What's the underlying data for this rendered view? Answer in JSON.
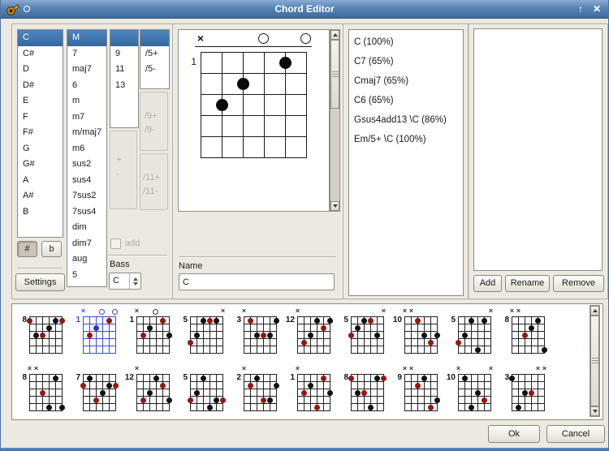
{
  "window": {
    "title": "Chord Editor",
    "maximize_glyph": "↑",
    "close_glyph": "✕"
  },
  "colors": {
    "titlebar_blue": "#5584b6",
    "selection_blue": "#35679f",
    "selected_diagram_blue": "#3f4cd9",
    "root_dot_red": "#991414",
    "note_dot_black": "#111111",
    "alt_dot_blue": "#2b35c8",
    "window_bg": "#ece9e2"
  },
  "roots": {
    "items": [
      "C",
      "C#",
      "D",
      "D#",
      "E",
      "F",
      "F#",
      "G",
      "G#",
      "A",
      "A#",
      "B"
    ],
    "selected": "C"
  },
  "accidentals": {
    "sharp": "#",
    "flat": "b",
    "active": "#"
  },
  "settings_button": "Settings",
  "types": {
    "items": [
      "M",
      "7",
      "maj7",
      "6",
      "m",
      "m7",
      "m/maj7",
      "m6",
      "sus2",
      "sus4",
      "7sus2",
      "7sus4",
      "dim",
      "dim7",
      "aug",
      "5"
    ],
    "selected": "M"
  },
  "extensions": {
    "items": [
      "9",
      "11",
      "13"
    ],
    "selected": ""
  },
  "plus_minus": {
    "plus": "+",
    "minus": "-"
  },
  "add_checkbox": {
    "label": "add",
    "checked": false,
    "enabled": false
  },
  "bass": {
    "label": "Bass",
    "value": "C"
  },
  "alterations": {
    "group5": [
      "/5+",
      "/5-"
    ],
    "group9": [
      "/9+",
      "/9-"
    ],
    "group11": [
      "/11+",
      "/11-"
    ]
  },
  "editor": {
    "fret": "1",
    "markers": [
      {
        "s": 1,
        "t": "x"
      },
      {
        "s": 4,
        "t": "o"
      },
      {
        "s": 6,
        "t": "o"
      }
    ],
    "dots": [
      {
        "s": 5,
        "f": 1
      },
      {
        "s": 3,
        "f": 2
      },
      {
        "s": 2,
        "f": 3
      }
    ],
    "name_label": "Name",
    "name_value": "C"
  },
  "chord_names": [
    "C (100%)",
    "C7 (65%)",
    "Cmaj7 (65%)",
    "C6 (65%)",
    "Gsus4add13 \\C (86%)",
    "Em/5+ \\C (100%)"
  ],
  "library_buttons": {
    "add": "Add",
    "rename": "Rename",
    "remove": "Remove"
  },
  "footer": {
    "ok": "Ok",
    "cancel": "Cancel"
  },
  "diagrams": {
    "rows": [
      [
        {
          "fret": "8",
          "m": [],
          "dots": [
            {
              "s": 1,
              "f": 1,
              "c": "r"
            },
            {
              "s": 5,
              "f": 1,
              "c": "k"
            },
            {
              "s": 6,
              "f": 1,
              "c": "r"
            },
            {
              "s": 4,
              "f": 2,
              "c": "k"
            },
            {
              "s": 2,
              "f": 3,
              "c": "k"
            },
            {
              "s": 3,
              "f": 3,
              "c": "r"
            }
          ]
        },
        {
          "fret": "1",
          "sel": true,
          "m": [
            {
              "s": 1,
              "t": "x"
            },
            {
              "s": 4,
              "t": "o"
            },
            {
              "s": 6,
              "t": "o"
            }
          ],
          "dots": [
            {
              "s": 5,
              "f": 1,
              "c": "r"
            },
            {
              "s": 3,
              "f": 2,
              "c": "b"
            },
            {
              "s": 2,
              "f": 3,
              "c": "r"
            }
          ]
        },
        {
          "fret": "1",
          "m": [
            {
              "s": 1,
              "t": "x"
            },
            {
              "s": 4,
              "t": "o"
            }
          ],
          "dots": [
            {
              "s": 5,
              "f": 1,
              "c": "r"
            },
            {
              "s": 3,
              "f": 2,
              "c": "k"
            },
            {
              "s": 2,
              "f": 3,
              "c": "r"
            },
            {
              "s": 6,
              "f": 3,
              "c": "k"
            }
          ]
        },
        {
          "fret": "5",
          "m": [
            {
              "s": 6,
              "t": "x"
            }
          ],
          "dots": [
            {
              "s": 3,
              "f": 1,
              "c": "k"
            },
            {
              "s": 4,
              "f": 1,
              "c": "r"
            },
            {
              "s": 5,
              "f": 1,
              "c": "k"
            },
            {
              "s": 2,
              "f": 3,
              "c": "k"
            },
            {
              "s": 1,
              "f": 4,
              "c": "r"
            }
          ]
        },
        {
          "fret": "3",
          "m": [
            {
              "s": 1,
              "t": "x"
            }
          ],
          "dots": [
            {
              "s": 2,
              "f": 1,
              "c": "r"
            },
            {
              "s": 6,
              "f": 1,
              "c": "k"
            },
            {
              "s": 3,
              "f": 3,
              "c": "k"
            },
            {
              "s": 4,
              "f": 3,
              "c": "r"
            },
            {
              "s": 5,
              "f": 3,
              "c": "k"
            }
          ]
        },
        {
          "fret": "12",
          "m": [
            {
              "s": 1,
              "t": "x"
            }
          ],
          "dots": [
            {
              "s": 4,
              "f": 1,
              "c": "k"
            },
            {
              "s": 6,
              "f": 1,
              "c": "k"
            },
            {
              "s": 5,
              "f": 2,
              "c": "r"
            },
            {
              "s": 3,
              "f": 3,
              "c": "k"
            },
            {
              "s": 2,
              "f": 4,
              "c": "r"
            }
          ]
        },
        {
          "fret": "5",
          "m": [
            {
              "s": 6,
              "t": "x"
            }
          ],
          "dots": [
            {
              "s": 3,
              "f": 1,
              "c": "k"
            },
            {
              "s": 4,
              "f": 1,
              "c": "r"
            },
            {
              "s": 2,
              "f": 2,
              "c": "k"
            },
            {
              "s": 1,
              "f": 3,
              "c": "r"
            },
            {
              "s": 5,
              "f": 3,
              "c": "k"
            }
          ]
        },
        {
          "fret": "10",
          "m": [
            {
              "s": 1,
              "t": "x"
            },
            {
              "s": 2,
              "t": "x"
            }
          ],
          "dots": [
            {
              "s": 3,
              "f": 1,
              "c": "r"
            },
            {
              "s": 4,
              "f": 3,
              "c": "k"
            },
            {
              "s": 6,
              "f": 3,
              "c": "k"
            },
            {
              "s": 5,
              "f": 4,
              "c": "r"
            }
          ]
        },
        {
          "fret": "5",
          "m": [
            {
              "s": 6,
              "t": "x"
            }
          ],
          "dots": [
            {
              "s": 3,
              "f": 1,
              "c": "k"
            },
            {
              "s": 5,
              "f": 1,
              "c": "k"
            },
            {
              "s": 2,
              "f": 3,
              "c": "k"
            },
            {
              "s": 1,
              "f": 4,
              "c": "r"
            },
            {
              "s": 4,
              "f": 5,
              "c": "k"
            }
          ]
        },
        {
          "fret": "8",
          "m": [
            {
              "s": 1,
              "t": "x"
            },
            {
              "s": 2,
              "t": "x"
            }
          ],
          "dots": [
            {
              "s": 5,
              "f": 1,
              "c": "k"
            },
            {
              "s": 4,
              "f": 2,
              "c": "k"
            },
            {
              "s": 3,
              "f": 3,
              "c": "r"
            },
            {
              "s": 6,
              "f": 5,
              "c": "k"
            }
          ]
        }
      ],
      [
        {
          "fret": "8",
          "m": [
            {
              "s": 1,
              "t": "x"
            },
            {
              "s": 2,
              "t": "x"
            }
          ],
          "dots": [
            {
              "s": 5,
              "f": 1,
              "c": "k"
            },
            {
              "s": 3,
              "f": 3,
              "c": "r"
            },
            {
              "s": 4,
              "f": 5,
              "c": "k"
            },
            {
              "s": 6,
              "f": 5,
              "c": "k"
            }
          ]
        },
        {
          "fret": "7",
          "m": [],
          "dots": [
            {
              "s": 2,
              "f": 1,
              "c": "k"
            },
            {
              "s": 1,
              "f": 2,
              "c": "r"
            },
            {
              "s": 5,
              "f": 2,
              "c": "k"
            },
            {
              "s": 6,
              "f": 2,
              "c": "r"
            },
            {
              "s": 4,
              "f": 3,
              "c": "k"
            },
            {
              "s": 3,
              "f": 4,
              "c": "r"
            }
          ]
        },
        {
          "fret": "12",
          "m": [
            {
              "s": 1,
              "t": "x"
            }
          ],
          "dots": [
            {
              "s": 4,
              "f": 1,
              "c": "k"
            },
            {
              "s": 5,
              "f": 2,
              "c": "r"
            },
            {
              "s": 3,
              "f": 3,
              "c": "k"
            },
            {
              "s": 2,
              "f": 4,
              "c": "r"
            },
            {
              "s": 6,
              "f": 4,
              "c": "k"
            }
          ]
        },
        {
          "fret": "5",
          "m": [],
          "dots": [
            {
              "s": 3,
              "f": 1,
              "c": "k"
            },
            {
              "s": 2,
              "f": 3,
              "c": "k"
            },
            {
              "s": 1,
              "f": 4,
              "c": "r"
            },
            {
              "s": 5,
              "f": 4,
              "c": "k"
            },
            {
              "s": 6,
              "f": 4,
              "c": "r"
            },
            {
              "s": 4,
              "f": 5,
              "c": "k"
            }
          ]
        },
        {
          "fret": "2",
          "m": [
            {
              "s": 1,
              "t": "x"
            }
          ],
          "dots": [
            {
              "s": 3,
              "f": 1,
              "c": "k"
            },
            {
              "s": 2,
              "f": 2,
              "c": "r"
            },
            {
              "s": 6,
              "f": 2,
              "c": "k"
            },
            {
              "s": 4,
              "f": 4,
              "c": "r"
            },
            {
              "s": 5,
              "f": 4,
              "c": "k"
            }
          ]
        },
        {
          "fret": "1",
          "m": [
            {
              "s": 1,
              "t": "x"
            }
          ],
          "dots": [
            {
              "s": 5,
              "f": 1,
              "c": "r"
            },
            {
              "s": 3,
              "f": 2,
              "c": "k"
            },
            {
              "s": 2,
              "f": 3,
              "c": "r"
            },
            {
              "s": 6,
              "f": 3,
              "c": "k"
            },
            {
              "s": 4,
              "f": 5,
              "c": "r"
            }
          ]
        },
        {
          "fret": "8",
          "m": [],
          "dots": [
            {
              "s": 1,
              "f": 1,
              "c": "r"
            },
            {
              "s": 5,
              "f": 1,
              "c": "k"
            },
            {
              "s": 6,
              "f": 1,
              "c": "r"
            },
            {
              "s": 2,
              "f": 3,
              "c": "k"
            },
            {
              "s": 3,
              "f": 3,
              "c": "r"
            },
            {
              "s": 4,
              "f": 5,
              "c": "k"
            }
          ]
        },
        {
          "fret": "9",
          "m": [
            {
              "s": 1,
              "t": "x"
            },
            {
              "s": 2,
              "t": "x"
            }
          ],
          "dots": [
            {
              "s": 4,
              "f": 1,
              "c": "k"
            },
            {
              "s": 3,
              "f": 2,
              "c": "r"
            },
            {
              "s": 6,
              "f": 4,
              "c": "k"
            },
            {
              "s": 5,
              "f": 5,
              "c": "r"
            }
          ]
        },
        {
          "fret": "10",
          "m": [
            {
              "s": 1,
              "t": "x"
            },
            {
              "s": 6,
              "t": "x"
            }
          ],
          "dots": [
            {
              "s": 2,
              "f": 1,
              "c": "k"
            },
            {
              "s": 4,
              "f": 3,
              "c": "k"
            },
            {
              "s": 5,
              "f": 4,
              "c": "r"
            },
            {
              "s": 3,
              "f": 5,
              "c": "k"
            }
          ]
        },
        {
          "fret": "3",
          "m": [
            {
              "s": 5,
              "t": "x"
            },
            {
              "s": 6,
              "t": "x"
            }
          ],
          "dots": [
            {
              "s": 1,
              "f": 1,
              "c": "k"
            },
            {
              "s": 3,
              "f": 3,
              "c": "k"
            },
            {
              "s": 4,
              "f": 3,
              "c": "r"
            },
            {
              "s": 2,
              "f": 5,
              "c": "k"
            }
          ]
        }
      ]
    ]
  }
}
